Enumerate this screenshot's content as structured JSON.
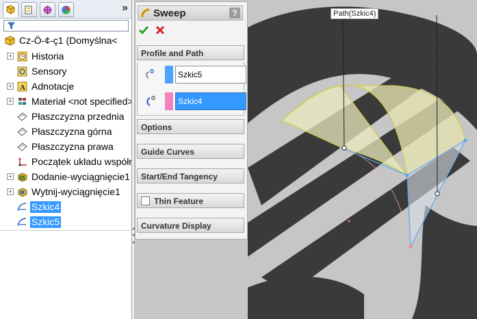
{
  "tree": {
    "tab_icons": [
      "feature-manager-icon",
      "property-manager-icon",
      "configuration-manager-icon",
      "display-manager-icon"
    ],
    "more_label": "»",
    "root_label": "Cz-Ö-¢-ç1  (Domyślna<",
    "items": [
      {
        "label": "Historia",
        "icon": "history-icon",
        "expandable": true
      },
      {
        "label": "Sensory",
        "icon": "sensor-icon",
        "expandable": false
      },
      {
        "label": "Adnotacje",
        "icon": "annotation-icon",
        "expandable": true
      },
      {
        "label": "Materiał <not specified>",
        "icon": "material-icon",
        "expandable": true
      },
      {
        "label": "Płaszczyzna przednia",
        "icon": "plane-icon",
        "expandable": false
      },
      {
        "label": "Płaszczyzna górna",
        "icon": "plane-icon",
        "expandable": false
      },
      {
        "label": "Płaszczyzna prawa",
        "icon": "plane-icon",
        "expandable": false
      },
      {
        "label": "Początek układu współrzędnych",
        "icon": "origin-icon",
        "expandable": false
      },
      {
        "label": "Dodanie-wyciągnięcie1",
        "icon": "extrude-icon",
        "expandable": true
      },
      {
        "label": "Wytnij-wyciągnięcie1",
        "icon": "cut-extrude-icon",
        "expandable": true
      },
      {
        "label": "Szkic4",
        "icon": "sketch-icon",
        "expandable": false,
        "selected": true
      },
      {
        "label": "Szkic5",
        "icon": "sketch-icon",
        "expandable": false,
        "selected": true
      }
    ]
  },
  "property_manager": {
    "title": "Sweep",
    "help_label": "?",
    "profile_and_path": {
      "header": "Profile and Path",
      "profile": {
        "value": "Szkic5",
        "swatch_color": "#4fa3ff"
      },
      "path": {
        "value": "Szkic4",
        "swatch_color": "#f283c0"
      }
    },
    "groups": [
      "Options",
      "Guide Curves",
      "Start/End Tangency",
      "Thin Feature",
      "Curvature Display"
    ],
    "thin_feature_checked": false
  },
  "viewport": {
    "callout_label": "Path(Szkic4)",
    "colors": {
      "background": "#c6c6c6",
      "stripes": "#3a3a3a",
      "sweep_surface": "#e9e8bc",
      "edges_blue": "#5aa8f0",
      "edges_pink": "#ef7fa3",
      "edges_yellow": "#cccc40"
    }
  }
}
